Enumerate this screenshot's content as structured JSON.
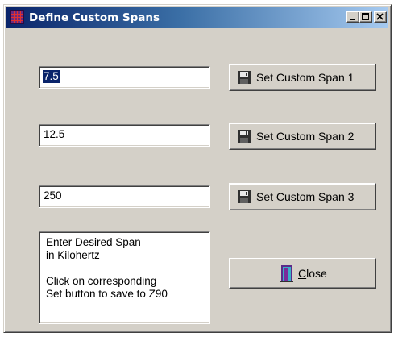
{
  "window": {
    "title": "Define Custom Spans"
  },
  "spans": [
    {
      "value": "7.5",
      "button_label": "Set Custom Span 1"
    },
    {
      "value": "12.5",
      "button_label": "Set Custom Span 2"
    },
    {
      "value": "250",
      "button_label": "Set Custom Span 3"
    }
  ],
  "instructions": {
    "lines": [
      "Enter Desired Span",
      "in Kilohertz",
      "",
      "Click on corresponding",
      "Set button to save to Z90"
    ]
  },
  "close_button": {
    "mnemonic": "C",
    "rest": "lose"
  },
  "icons": {
    "title": "grid-icon",
    "set_buttons": "floppy-disk-icon",
    "close": "door-exit-icon"
  },
  "colors": {
    "titlebar_start": "#0a246a",
    "titlebar_end": "#a6caf0",
    "face": "#d4d0c8",
    "selection": "#0a246a"
  }
}
